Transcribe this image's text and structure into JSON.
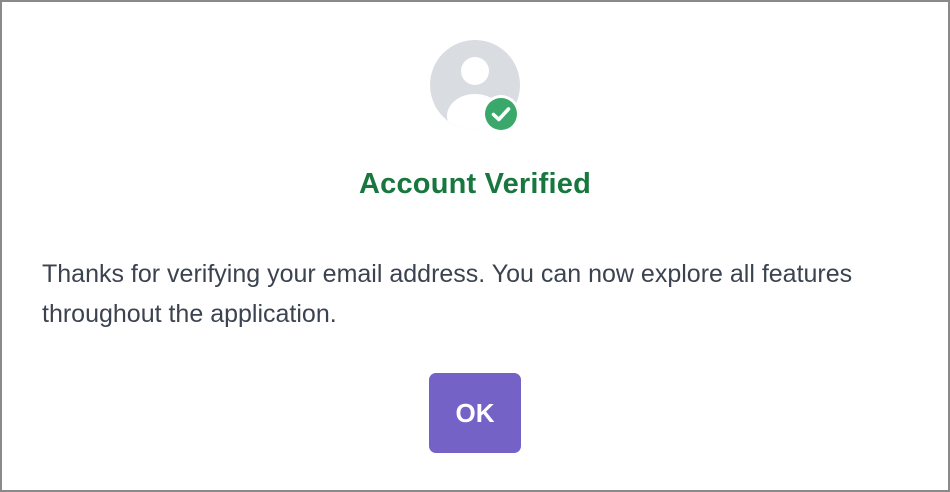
{
  "dialog": {
    "icon": "user-avatar-icon",
    "badge_icon": "check-circle-icon",
    "title": "Account Verified",
    "message": "Thanks for verifying your email address. You can now explore all features throughout the application.",
    "ok_label": "OK"
  },
  "colors": {
    "title": "#17773f",
    "button": "#7462c7",
    "badge": "#3aa86b",
    "avatar": "#d8dbe0"
  }
}
